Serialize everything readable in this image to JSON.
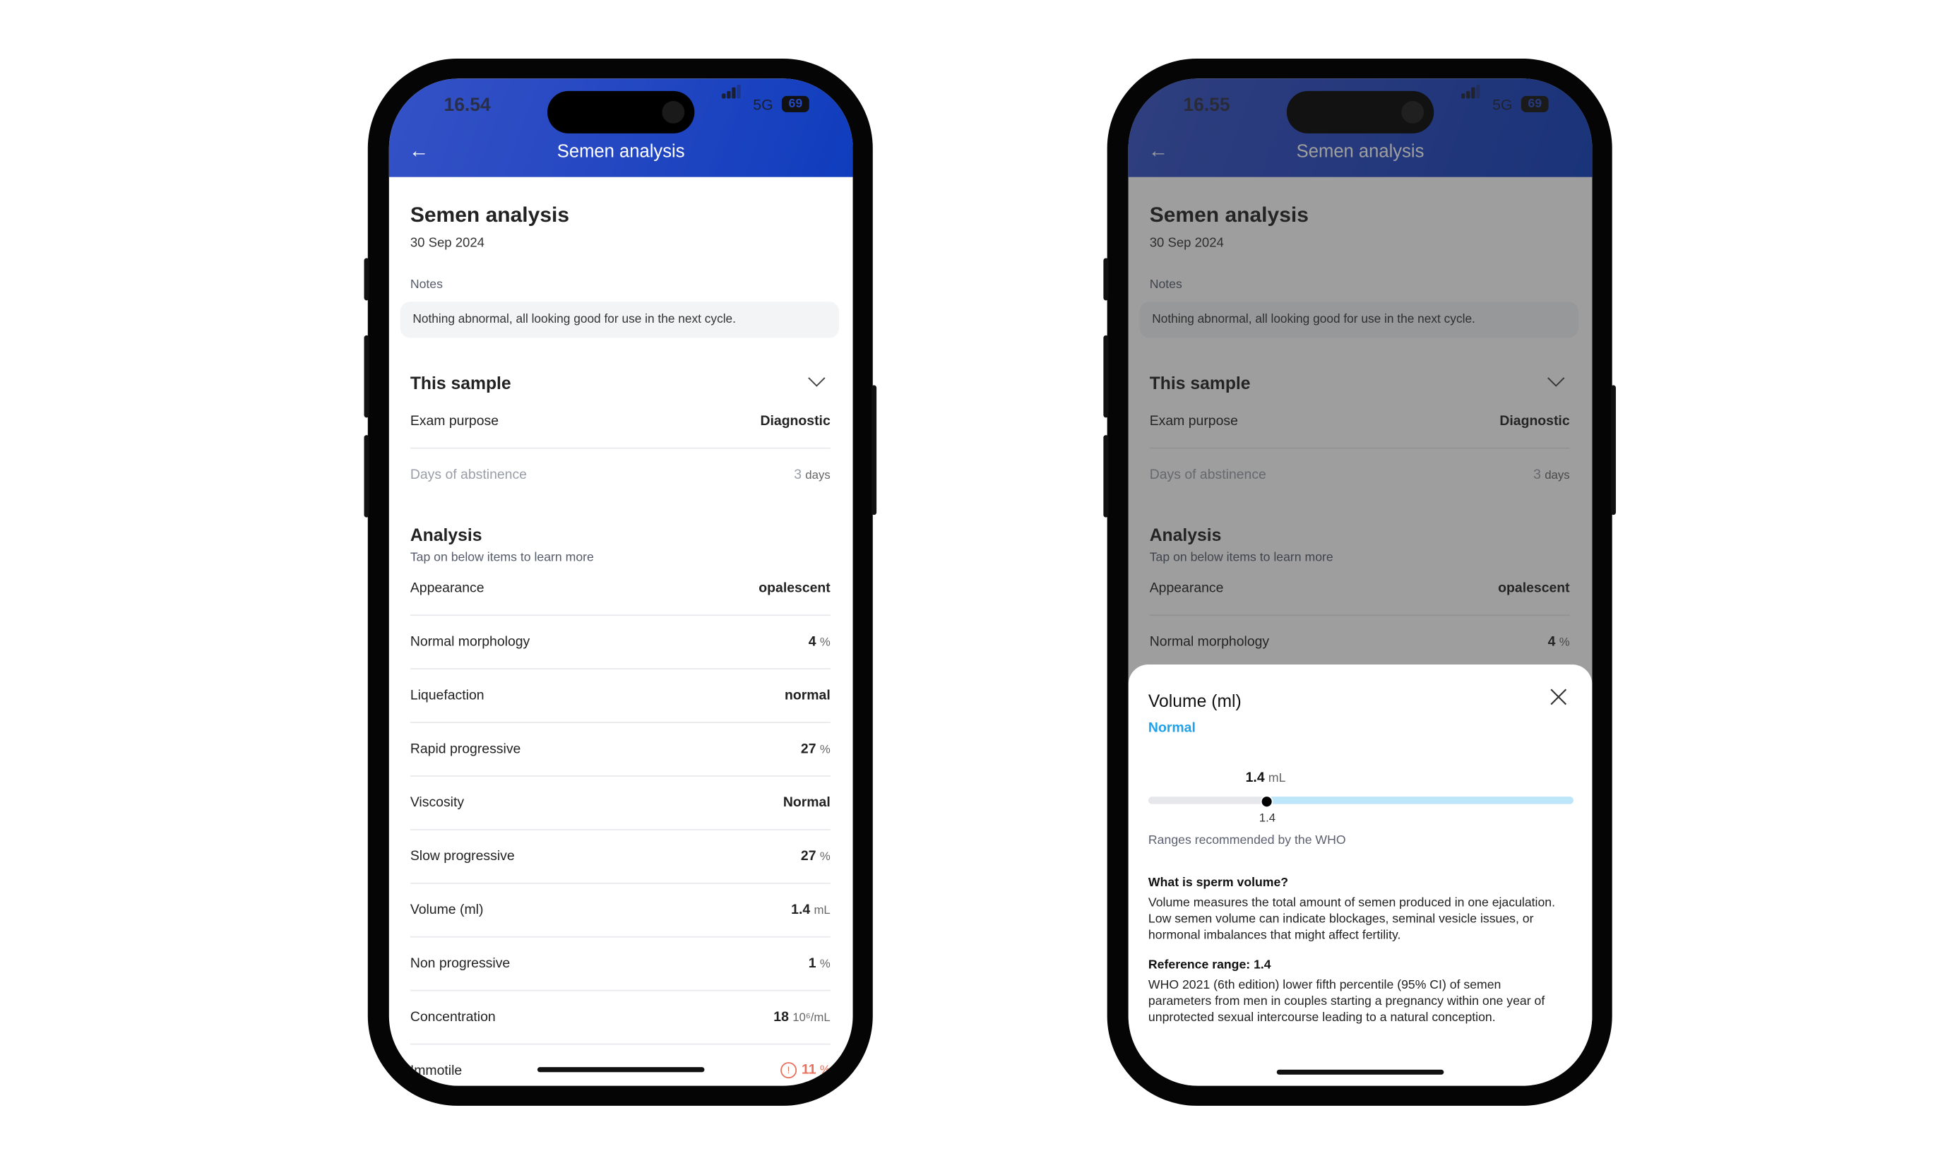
{
  "phones": [
    {
      "time": "16.54",
      "network": "5G",
      "battery": "69"
    },
    {
      "time": "16.55",
      "network": "5G",
      "battery": "69"
    }
  ],
  "header": {
    "title": "Semen analysis",
    "back_icon": "arrow-left-icon"
  },
  "page": {
    "title": "Semen analysis",
    "date": "30 Sep 2024",
    "notes_label": "Notes",
    "notes": "Nothing abnormal, all looking good for use in the next cycle."
  },
  "sample": {
    "title": "This sample",
    "rows": [
      {
        "label": "Exam purpose",
        "value": "Diagnostic",
        "unit": ""
      },
      {
        "label": "Days of abstinence",
        "value": "3",
        "unit": "days",
        "muted": true
      }
    ]
  },
  "analysis": {
    "title": "Analysis",
    "subtitle": "Tap on below items to learn more",
    "rows": [
      {
        "label": "Appearance",
        "value": "opalescent",
        "unit": ""
      },
      {
        "label": "Normal morphology",
        "value": "4",
        "unit": "%"
      },
      {
        "label": "Liquefaction",
        "value": "normal",
        "unit": ""
      },
      {
        "label": "Rapid progressive",
        "value": "27",
        "unit": "%"
      },
      {
        "label": "Viscosity",
        "value": "Normal",
        "unit": ""
      },
      {
        "label": "Slow progressive",
        "value": "27",
        "unit": "%"
      },
      {
        "label": "Volume (ml)",
        "value": "1.4",
        "unit": "mL"
      },
      {
        "label": "Non progressive",
        "value": "1",
        "unit": "%"
      },
      {
        "label": "Concentration",
        "value": "18",
        "unit": "10⁶/mL"
      },
      {
        "label": "Immotile",
        "value": "11",
        "unit": "%",
        "alert": true
      }
    ]
  },
  "sheet": {
    "title": "Volume (ml)",
    "status": "Normal",
    "status_color": "#1fa2ea",
    "value": "1.4",
    "unit": "mL",
    "marker_fraction": 0.28,
    "tick_label": "1.4",
    "ranges_note": "Ranges recommended by the WHO",
    "question": "What is sperm volume?",
    "answer": "Volume measures the total amount of semen produced in one ejaculation. Low semen volume can indicate blockages, seminal vesicle issues, or hormonal imbalances that might affect fertility.",
    "reference_title": "Reference range: 1.4",
    "reference_text": "WHO 2021 (6th edition) lower fifth percentile (95% CI) of semen parameters from men in couples starting a pregnancy within one year of unprotected sexual intercourse leading to a natural conception."
  },
  "colors": {
    "header_start": "#3552c6",
    "header_end": "#0f3dbd",
    "alert": "#e8705a",
    "range_fill": "#bde6fb"
  }
}
